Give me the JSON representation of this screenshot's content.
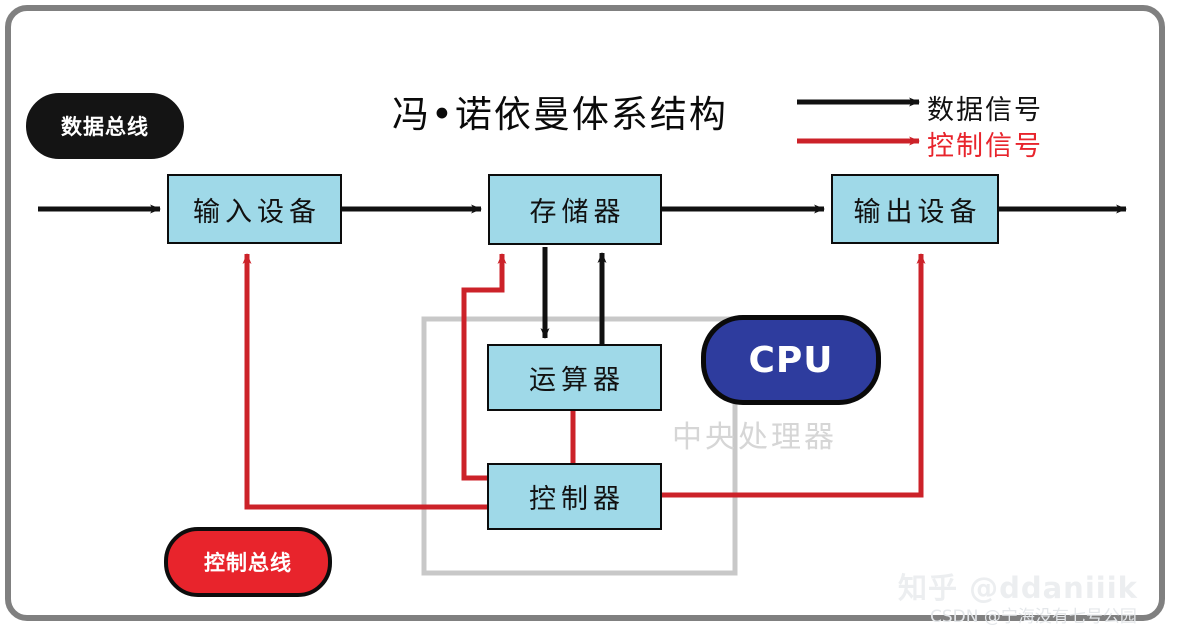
{
  "title": "冯•诺依曼体系结构",
  "legend": {
    "data_signal": "数据信号",
    "control_signal": "控制信号",
    "data_color": "#111111",
    "control_color": "#cc2229"
  },
  "buses": {
    "data_bus": "数据总线",
    "control_bus": "控制总线",
    "data_bus_bg": "#141414",
    "control_bus_bg": "#e8242c"
  },
  "nodes": {
    "input_device": "输入设备",
    "memory": "存储器",
    "output_device": "输出设备",
    "alu": "运算器",
    "controller": "控制器",
    "node_fill": "#9fd9e8"
  },
  "cpu": {
    "badge": "CPU",
    "badge_bg": "#2e3c9e",
    "boundary_label": "中央处理器",
    "boundary_color": "#c8c8c8"
  },
  "watermarks": {
    "zhihu": "知乎 @ddaniiik",
    "csdn": "CSDN @宁海没有七号公园"
  }
}
